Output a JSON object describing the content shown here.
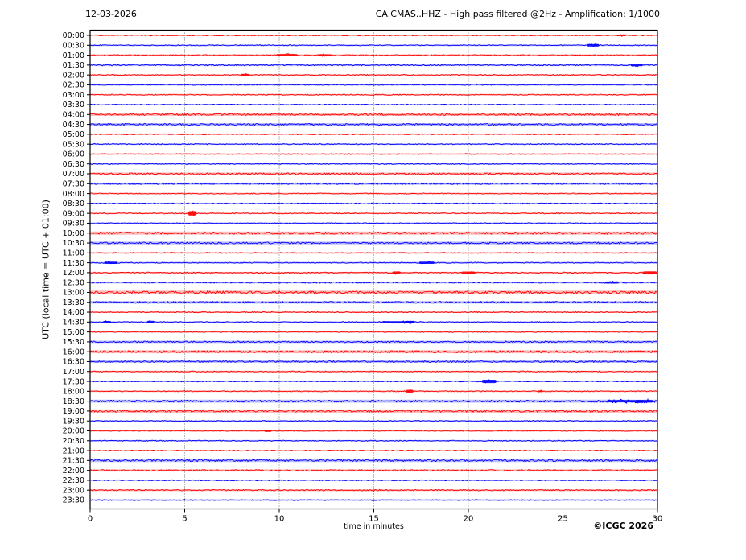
{
  "footer": {
    "copyright": "©ICGC 2026"
  },
  "chart_data": {
    "type": "line",
    "subtype": "helicorder-day-plot",
    "date_label": "12-03-2026",
    "title": "CA.CMAS..HHZ - High pass filtered @2Hz - Amplification: 1/1000",
    "xlabel": "time in minutes",
    "ylabel": "UTC (local time = UTC + 01:00)",
    "xlim": [
      0,
      30
    ],
    "x_ticks": [
      0,
      5,
      10,
      15,
      20,
      25,
      30
    ],
    "grid_minutes": [
      5,
      10,
      15,
      20,
      25
    ],
    "grid_on": true,
    "colors": {
      "red_trace": "#ff0000",
      "blue_trace": "#0000ff",
      "grid": "#555555",
      "axis": "#000000",
      "text": "#000000"
    },
    "rows": [
      {
        "label": "00:00",
        "color": "red",
        "amp": 0.8,
        "events": [
          {
            "t": 28.1,
            "w": 0.2,
            "a": 1.0
          }
        ]
      },
      {
        "label": "00:30",
        "color": "blue",
        "amp": 0.8,
        "events": [
          {
            "t": 26.6,
            "w": 0.25,
            "a": 1.8
          }
        ]
      },
      {
        "label": "01:00",
        "color": "red",
        "amp": 0.9,
        "events": [
          {
            "t": 10.4,
            "w": 0.5,
            "a": 1.6
          },
          {
            "t": 12.4,
            "w": 0.3,
            "a": 1.2
          }
        ]
      },
      {
        "label": "01:30",
        "color": "blue",
        "amp": 1.1,
        "events": [
          {
            "t": 28.9,
            "w": 0.25,
            "a": 1.6
          }
        ]
      },
      {
        "label": "02:00",
        "color": "red",
        "amp": 0.8,
        "events": [
          {
            "t": 8.2,
            "w": 0.15,
            "a": 1.5
          }
        ]
      },
      {
        "label": "02:30",
        "color": "blue",
        "amp": 0.8,
        "events": []
      },
      {
        "label": "03:00",
        "color": "red",
        "amp": 0.8,
        "events": []
      },
      {
        "label": "03:30",
        "color": "blue",
        "amp": 0.8,
        "events": []
      },
      {
        "label": "04:00",
        "color": "red",
        "amp": 1.4,
        "events": []
      },
      {
        "label": "04:30",
        "color": "blue",
        "amp": 1.3,
        "events": []
      },
      {
        "label": "05:00",
        "color": "red",
        "amp": 0.8,
        "events": []
      },
      {
        "label": "05:30",
        "color": "blue",
        "amp": 0.8,
        "events": []
      },
      {
        "label": "06:00",
        "color": "red",
        "amp": 0.8,
        "events": []
      },
      {
        "label": "06:30",
        "color": "blue",
        "amp": 0.8,
        "events": []
      },
      {
        "label": "07:00",
        "color": "red",
        "amp": 1.4,
        "events": []
      },
      {
        "label": "07:30",
        "color": "blue",
        "amp": 1.2,
        "events": []
      },
      {
        "label": "08:00",
        "color": "red",
        "amp": 0.8,
        "events": []
      },
      {
        "label": "08:30",
        "color": "blue",
        "amp": 0.8,
        "events": []
      },
      {
        "label": "09:00",
        "color": "red",
        "amp": 0.8,
        "events": [
          {
            "t": 5.4,
            "w": 0.12,
            "a": 3.5
          }
        ]
      },
      {
        "label": "09:30",
        "color": "blue",
        "amp": 0.8,
        "events": []
      },
      {
        "label": "10:00",
        "color": "red",
        "amp": 1.7,
        "events": []
      },
      {
        "label": "10:30",
        "color": "blue",
        "amp": 1.4,
        "events": []
      },
      {
        "label": "11:00",
        "color": "red",
        "amp": 0.8,
        "events": []
      },
      {
        "label": "11:30",
        "color": "blue",
        "amp": 0.8,
        "events": [
          {
            "t": 1.1,
            "w": 0.3,
            "a": 1.5
          },
          {
            "t": 17.8,
            "w": 0.35,
            "a": 1.5
          }
        ]
      },
      {
        "label": "12:00",
        "color": "red",
        "amp": 0.9,
        "events": [
          {
            "t": 16.2,
            "w": 0.15,
            "a": 1.8
          },
          {
            "t": 20.0,
            "w": 0.3,
            "a": 1.5
          },
          {
            "t": 29.6,
            "w": 0.3,
            "a": 2.0
          }
        ]
      },
      {
        "label": "12:30",
        "color": "blue",
        "amp": 1.0,
        "events": [
          {
            "t": 27.6,
            "w": 0.3,
            "a": 1.5
          }
        ]
      },
      {
        "label": "13:00",
        "color": "red",
        "amp": 1.9,
        "events": []
      },
      {
        "label": "13:30",
        "color": "blue",
        "amp": 1.4,
        "events": []
      },
      {
        "label": "14:00",
        "color": "red",
        "amp": 0.8,
        "events": []
      },
      {
        "label": "14:30",
        "color": "blue",
        "amp": 0.8,
        "events": [
          {
            "t": 0.9,
            "w": 0.15,
            "a": 1.5
          },
          {
            "t": 3.2,
            "w": 0.12,
            "a": 1.8
          },
          {
            "t": 16.3,
            "w": 0.8,
            "a": 1.2
          },
          {
            "t": 16.9,
            "w": 0.2,
            "a": 1.6
          }
        ]
      },
      {
        "label": "15:00",
        "color": "red",
        "amp": 0.8,
        "events": []
      },
      {
        "label": "15:30",
        "color": "blue",
        "amp": 1.2,
        "events": []
      },
      {
        "label": "16:00",
        "color": "red",
        "amp": 1.6,
        "events": []
      },
      {
        "label": "16:30",
        "color": "blue",
        "amp": 1.2,
        "events": []
      },
      {
        "label": "17:00",
        "color": "red",
        "amp": 0.8,
        "events": []
      },
      {
        "label": "17:30",
        "color": "blue",
        "amp": 0.8,
        "events": [
          {
            "t": 21.1,
            "w": 0.3,
            "a": 2.5
          }
        ]
      },
      {
        "label": "18:00",
        "color": "red",
        "amp": 0.8,
        "events": [
          {
            "t": 16.9,
            "w": 0.12,
            "a": 2.2
          },
          {
            "t": 23.8,
            "w": 0.1,
            "a": 1.0
          }
        ]
      },
      {
        "label": "18:30",
        "color": "blue",
        "amp": 1.6,
        "events": [
          {
            "t": 28.3,
            "w": 0.9,
            "a": 1.6
          },
          {
            "t": 29.3,
            "w": 0.4,
            "a": 1.8
          }
        ]
      },
      {
        "label": "19:00",
        "color": "red",
        "amp": 1.7,
        "events": []
      },
      {
        "label": "19:30",
        "color": "blue",
        "amp": 0.8,
        "events": []
      },
      {
        "label": "20:00",
        "color": "red",
        "amp": 0.8,
        "events": [
          {
            "t": 9.4,
            "w": 0.12,
            "a": 1.6
          }
        ]
      },
      {
        "label": "20:30",
        "color": "blue",
        "amp": 0.8,
        "events": []
      },
      {
        "label": "21:00",
        "color": "red",
        "amp": 0.8,
        "events": []
      },
      {
        "label": "21:30",
        "color": "blue",
        "amp": 1.6,
        "events": []
      },
      {
        "label": "22:00",
        "color": "red",
        "amp": 1.2,
        "events": []
      },
      {
        "label": "22:30",
        "color": "blue",
        "amp": 0.8,
        "events": []
      },
      {
        "label": "23:00",
        "color": "red",
        "amp": 1.0,
        "events": []
      },
      {
        "label": "23:30",
        "color": "blue",
        "amp": 0.8,
        "events": []
      }
    ]
  }
}
